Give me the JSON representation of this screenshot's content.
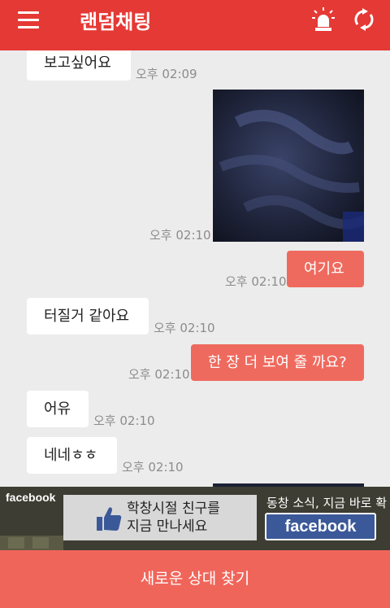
{
  "header": {
    "title": "랜덤채팅",
    "background": "#e53935"
  },
  "messages": [
    {
      "dir": "in",
      "type": "text",
      "text": "보고싶어요",
      "time": "오후 02:09"
    },
    {
      "dir": "in",
      "type": "image",
      "time": "오후 02:10"
    },
    {
      "dir": "out",
      "type": "text",
      "text": "여기요",
      "time": "오후 02:10"
    },
    {
      "dir": "in",
      "type": "text",
      "text": "터질거 같아요",
      "time": "오후 02:10"
    },
    {
      "dir": "out",
      "type": "text",
      "text": "한 장 더 보여 줄 까요?",
      "time": "오후 02:10"
    },
    {
      "dir": "in",
      "type": "text",
      "text": "어유",
      "time": "오후 02:10"
    },
    {
      "dir": "in",
      "type": "text",
      "text": "네네ㅎㅎ",
      "time": "오후 02:10"
    }
  ],
  "ad": {
    "brand_small": "facebook",
    "line1": "학창시절 친구를",
    "line2": "지금 만나세요",
    "news": "동창 소식, 지금 바로 확인!",
    "brand_button": "facebook"
  },
  "bottom": {
    "label": "새로운 상대 찾기"
  },
  "colors": {
    "accent": "#e53935",
    "outgoing_bubble": "#ef6a5e",
    "incoming_bubble": "#ffffff",
    "facebook_blue": "#3b5998"
  }
}
